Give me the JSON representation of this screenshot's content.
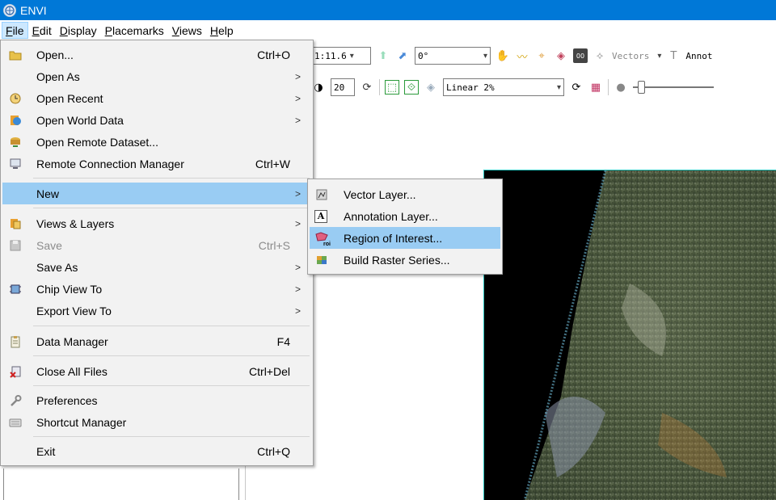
{
  "window": {
    "title": "ENVI"
  },
  "menubar": [
    {
      "key": "F",
      "rest": "ile",
      "active": true
    },
    {
      "key": "E",
      "rest": "dit",
      "active": false
    },
    {
      "key": "D",
      "rest": "isplay",
      "active": false
    },
    {
      "key": "P",
      "rest": "lacemarks",
      "active": false
    },
    {
      "key": "V",
      "rest": "iews",
      "active": false
    },
    {
      "key": "H",
      "rest": "elp",
      "active": false
    }
  ],
  "toolbar": {
    "zoom_value": "1:11.6",
    "rotation_value": "0°",
    "vectors_label": "Vectors",
    "annotation_label": "Annot",
    "brightness_value": "20",
    "stretch_value": "Linear 2%"
  },
  "file_menu": {
    "items": [
      {
        "label": "Open...",
        "shortcut": "Ctrl+O",
        "icon": "folder-open-icon"
      },
      {
        "label": "Open As",
        "submenu": true
      },
      {
        "label": "Open Recent",
        "submenu": true,
        "icon": "recent-icon"
      },
      {
        "label": "Open World Data",
        "submenu": true,
        "icon": "world-data-icon"
      },
      {
        "label": "Open Remote Dataset...",
        "icon": "remote-dataset-icon"
      },
      {
        "label": "Remote Connection Manager",
        "shortcut": "Ctrl+W",
        "icon": "connection-manager-icon"
      },
      {
        "label": "New",
        "submenu": true,
        "highlighted": true
      },
      {
        "label": "Views & Layers",
        "submenu": true,
        "icon": "views-layers-icon"
      },
      {
        "label": "Save",
        "shortcut": "Ctrl+S",
        "disabled": true,
        "icon": "save-icon"
      },
      {
        "label": "Save As",
        "submenu": true
      },
      {
        "label": "Chip View To",
        "submenu": true,
        "icon": "chip-view-icon"
      },
      {
        "label": "Export View To",
        "submenu": true
      },
      {
        "label": "Data Manager",
        "shortcut": "F4",
        "icon": "data-manager-icon"
      },
      {
        "label": "Close All Files",
        "shortcut": "Ctrl+Del",
        "icon": "close-files-icon"
      },
      {
        "label": "Preferences",
        "icon": "wrench-icon"
      },
      {
        "label": "Shortcut Manager",
        "icon": "keyboard-icon"
      },
      {
        "label": "Exit",
        "shortcut": "Ctrl+Q"
      }
    ]
  },
  "new_submenu": {
    "items": [
      {
        "label": "Vector Layer...",
        "icon": "vector-layer-icon"
      },
      {
        "label": "Annotation Layer...",
        "icon": "annotation-layer-icon",
        "icon_text": "A"
      },
      {
        "label": "Region of Interest...",
        "icon": "roi-icon",
        "icon_text": "roi",
        "highlighted": true
      },
      {
        "label": "Build Raster Series...",
        "icon": "raster-series-icon"
      }
    ]
  },
  "colors": {
    "titlebar": "#0078d7",
    "menu_highlight": "#99ccf3",
    "image_border": "#28c6c0"
  }
}
